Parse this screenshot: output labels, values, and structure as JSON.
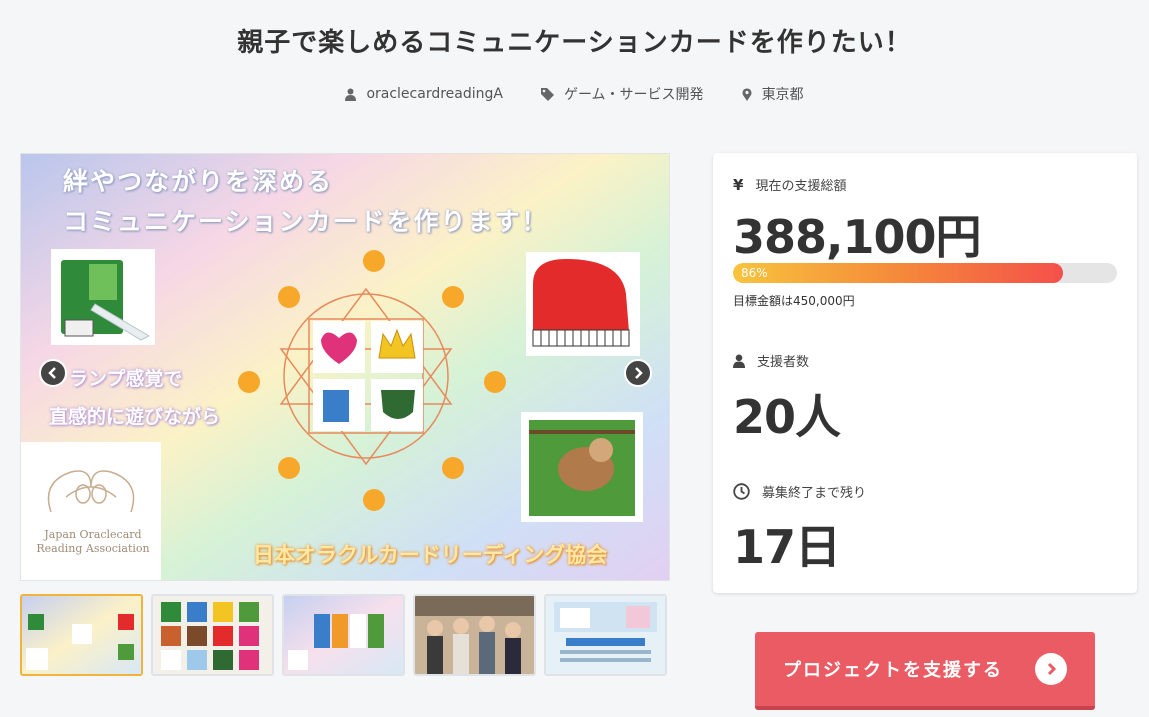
{
  "project": {
    "title": "親子で楽しめるコミュニケーションカードを作りたい！",
    "owner": "oraclecardreadingA",
    "category": "ゲーム・サービス開発",
    "location": "東京都"
  },
  "slide": {
    "heading_line1": "絆やつながりを深める",
    "heading_line2": "コミュニケーションカードを作ります！",
    "mid_line1": "ランプ感覚で",
    "mid_line2": "直感的に遊びながら",
    "footer": "日本オラクルカードリーディング協会",
    "logo_text_line1": "Japan Oraclecard",
    "logo_text_line2": "Reading Association",
    "active_index": 0
  },
  "thumbnails": [
    {
      "name": "thumb-1",
      "active": true
    },
    {
      "name": "thumb-2",
      "active": false
    },
    {
      "name": "thumb-3",
      "active": false
    },
    {
      "name": "thumb-4",
      "active": false
    },
    {
      "name": "thumb-5",
      "active": false
    }
  ],
  "stats": {
    "funding_label": "現在の支援総額",
    "funding_amount": "388,100円",
    "progress_percent": 86,
    "progress_label": "86%",
    "goal_text": "目標金額は450,000円",
    "supporters_label": "支援者数",
    "supporters_count": "20人",
    "remaining_label": "募集終了まで残り",
    "remaining_days": "17日"
  },
  "cta": {
    "label": "プロジェクトを支援する"
  },
  "icons": {
    "owner": "user-icon",
    "category": "tag-icon",
    "location": "map-pin-icon",
    "funding": "yen-icon",
    "supporters": "user-icon",
    "remaining": "clock-icon",
    "prev": "chevron-left-icon",
    "next": "chevron-right-icon",
    "cta": "chevron-right-circle-icon"
  },
  "colors": {
    "cta_background": "#ea5b64",
    "progress_start": "#f8c43d",
    "progress_end": "#f4504a",
    "active_thumb_border": "#f0b43c"
  }
}
